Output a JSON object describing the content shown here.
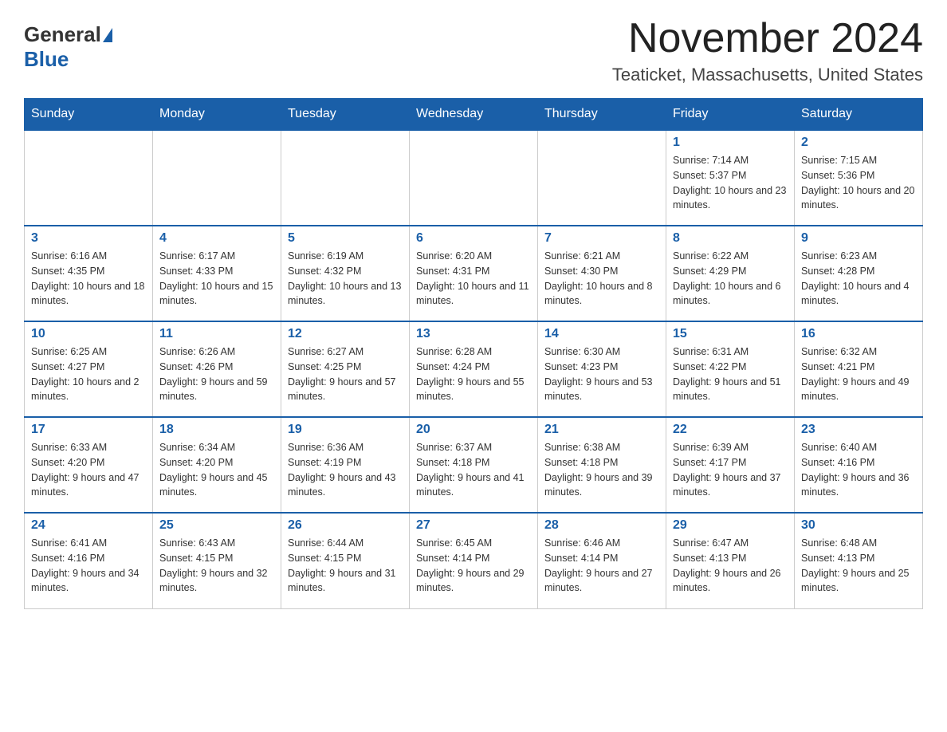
{
  "header": {
    "logo_general": "General",
    "logo_blue": "Blue",
    "month_title": "November 2024",
    "location": "Teaticket, Massachusetts, United States"
  },
  "weekdays": [
    "Sunday",
    "Monday",
    "Tuesday",
    "Wednesday",
    "Thursday",
    "Friday",
    "Saturday"
  ],
  "weeks": [
    [
      {
        "day": "",
        "sunrise": "",
        "sunset": "",
        "daylight": ""
      },
      {
        "day": "",
        "sunrise": "",
        "sunset": "",
        "daylight": ""
      },
      {
        "day": "",
        "sunrise": "",
        "sunset": "",
        "daylight": ""
      },
      {
        "day": "",
        "sunrise": "",
        "sunset": "",
        "daylight": ""
      },
      {
        "day": "",
        "sunrise": "",
        "sunset": "",
        "daylight": ""
      },
      {
        "day": "1",
        "sunrise": "Sunrise: 7:14 AM",
        "sunset": "Sunset: 5:37 PM",
        "daylight": "Daylight: 10 hours and 23 minutes."
      },
      {
        "day": "2",
        "sunrise": "Sunrise: 7:15 AM",
        "sunset": "Sunset: 5:36 PM",
        "daylight": "Daylight: 10 hours and 20 minutes."
      }
    ],
    [
      {
        "day": "3",
        "sunrise": "Sunrise: 6:16 AM",
        "sunset": "Sunset: 4:35 PM",
        "daylight": "Daylight: 10 hours and 18 minutes."
      },
      {
        "day": "4",
        "sunrise": "Sunrise: 6:17 AM",
        "sunset": "Sunset: 4:33 PM",
        "daylight": "Daylight: 10 hours and 15 minutes."
      },
      {
        "day": "5",
        "sunrise": "Sunrise: 6:19 AM",
        "sunset": "Sunset: 4:32 PM",
        "daylight": "Daylight: 10 hours and 13 minutes."
      },
      {
        "day": "6",
        "sunrise": "Sunrise: 6:20 AM",
        "sunset": "Sunset: 4:31 PM",
        "daylight": "Daylight: 10 hours and 11 minutes."
      },
      {
        "day": "7",
        "sunrise": "Sunrise: 6:21 AM",
        "sunset": "Sunset: 4:30 PM",
        "daylight": "Daylight: 10 hours and 8 minutes."
      },
      {
        "day": "8",
        "sunrise": "Sunrise: 6:22 AM",
        "sunset": "Sunset: 4:29 PM",
        "daylight": "Daylight: 10 hours and 6 minutes."
      },
      {
        "day": "9",
        "sunrise": "Sunrise: 6:23 AM",
        "sunset": "Sunset: 4:28 PM",
        "daylight": "Daylight: 10 hours and 4 minutes."
      }
    ],
    [
      {
        "day": "10",
        "sunrise": "Sunrise: 6:25 AM",
        "sunset": "Sunset: 4:27 PM",
        "daylight": "Daylight: 10 hours and 2 minutes."
      },
      {
        "day": "11",
        "sunrise": "Sunrise: 6:26 AM",
        "sunset": "Sunset: 4:26 PM",
        "daylight": "Daylight: 9 hours and 59 minutes."
      },
      {
        "day": "12",
        "sunrise": "Sunrise: 6:27 AM",
        "sunset": "Sunset: 4:25 PM",
        "daylight": "Daylight: 9 hours and 57 minutes."
      },
      {
        "day": "13",
        "sunrise": "Sunrise: 6:28 AM",
        "sunset": "Sunset: 4:24 PM",
        "daylight": "Daylight: 9 hours and 55 minutes."
      },
      {
        "day": "14",
        "sunrise": "Sunrise: 6:30 AM",
        "sunset": "Sunset: 4:23 PM",
        "daylight": "Daylight: 9 hours and 53 minutes."
      },
      {
        "day": "15",
        "sunrise": "Sunrise: 6:31 AM",
        "sunset": "Sunset: 4:22 PM",
        "daylight": "Daylight: 9 hours and 51 minutes."
      },
      {
        "day": "16",
        "sunrise": "Sunrise: 6:32 AM",
        "sunset": "Sunset: 4:21 PM",
        "daylight": "Daylight: 9 hours and 49 minutes."
      }
    ],
    [
      {
        "day": "17",
        "sunrise": "Sunrise: 6:33 AM",
        "sunset": "Sunset: 4:20 PM",
        "daylight": "Daylight: 9 hours and 47 minutes."
      },
      {
        "day": "18",
        "sunrise": "Sunrise: 6:34 AM",
        "sunset": "Sunset: 4:20 PM",
        "daylight": "Daylight: 9 hours and 45 minutes."
      },
      {
        "day": "19",
        "sunrise": "Sunrise: 6:36 AM",
        "sunset": "Sunset: 4:19 PM",
        "daylight": "Daylight: 9 hours and 43 minutes."
      },
      {
        "day": "20",
        "sunrise": "Sunrise: 6:37 AM",
        "sunset": "Sunset: 4:18 PM",
        "daylight": "Daylight: 9 hours and 41 minutes."
      },
      {
        "day": "21",
        "sunrise": "Sunrise: 6:38 AM",
        "sunset": "Sunset: 4:18 PM",
        "daylight": "Daylight: 9 hours and 39 minutes."
      },
      {
        "day": "22",
        "sunrise": "Sunrise: 6:39 AM",
        "sunset": "Sunset: 4:17 PM",
        "daylight": "Daylight: 9 hours and 37 minutes."
      },
      {
        "day": "23",
        "sunrise": "Sunrise: 6:40 AM",
        "sunset": "Sunset: 4:16 PM",
        "daylight": "Daylight: 9 hours and 36 minutes."
      }
    ],
    [
      {
        "day": "24",
        "sunrise": "Sunrise: 6:41 AM",
        "sunset": "Sunset: 4:16 PM",
        "daylight": "Daylight: 9 hours and 34 minutes."
      },
      {
        "day": "25",
        "sunrise": "Sunrise: 6:43 AM",
        "sunset": "Sunset: 4:15 PM",
        "daylight": "Daylight: 9 hours and 32 minutes."
      },
      {
        "day": "26",
        "sunrise": "Sunrise: 6:44 AM",
        "sunset": "Sunset: 4:15 PM",
        "daylight": "Daylight: 9 hours and 31 minutes."
      },
      {
        "day": "27",
        "sunrise": "Sunrise: 6:45 AM",
        "sunset": "Sunset: 4:14 PM",
        "daylight": "Daylight: 9 hours and 29 minutes."
      },
      {
        "day": "28",
        "sunrise": "Sunrise: 6:46 AM",
        "sunset": "Sunset: 4:14 PM",
        "daylight": "Daylight: 9 hours and 27 minutes."
      },
      {
        "day": "29",
        "sunrise": "Sunrise: 6:47 AM",
        "sunset": "Sunset: 4:13 PM",
        "daylight": "Daylight: 9 hours and 26 minutes."
      },
      {
        "day": "30",
        "sunrise": "Sunrise: 6:48 AM",
        "sunset": "Sunset: 4:13 PM",
        "daylight": "Daylight: 9 hours and 25 minutes."
      }
    ]
  ]
}
